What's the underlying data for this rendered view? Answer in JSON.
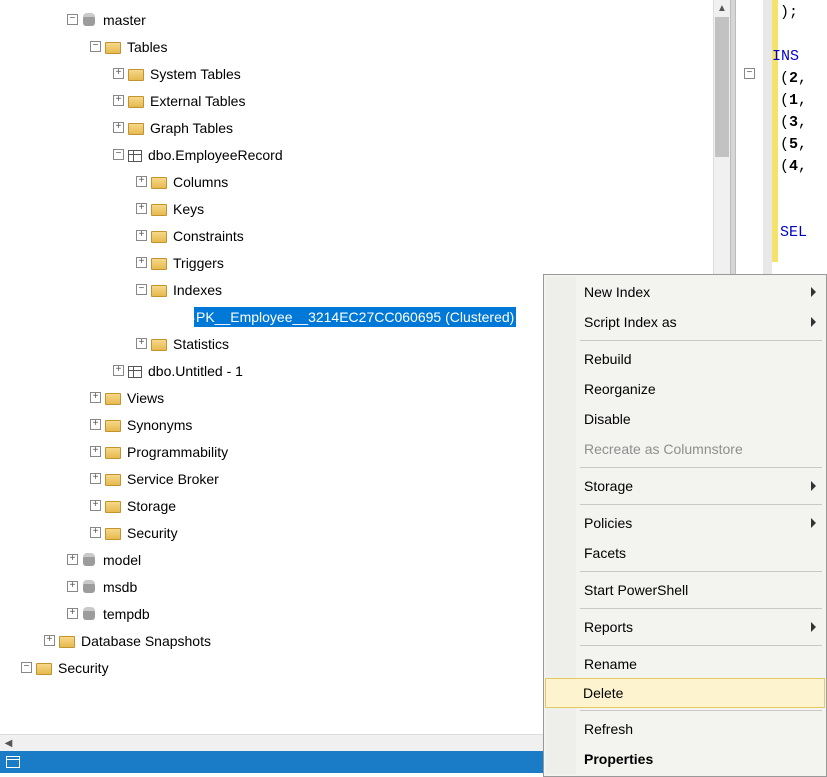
{
  "tree": {
    "master": "master",
    "tables": "Tables",
    "system_tables": "System Tables",
    "external_tables": "External Tables",
    "graph_tables": "Graph Tables",
    "employee_record": "dbo.EmployeeRecord",
    "columns": "Columns",
    "keys": "Keys",
    "constraints": "Constraints",
    "triggers": "Triggers",
    "indexes": "Indexes",
    "pk_index": "PK__Employee__3214EC27CC060695 (Clustered)",
    "statistics": "Statistics",
    "untitled": "dbo.Untitled - 1",
    "views": "Views",
    "synonyms": "Synonyms",
    "programmability": "Programmability",
    "service_broker": "Service Broker",
    "storage": "Storage",
    "security": "Security",
    "model": "model",
    "msdb": "msdb",
    "tempdb": "tempdb",
    "database_snapshots": "Database Snapshots",
    "root_security": "Security"
  },
  "menu": {
    "new_index": "New Index",
    "script_index": "Script Index as",
    "rebuild": "Rebuild",
    "reorganize": "Reorganize",
    "disable": "Disable",
    "recreate_columnstore": "Recreate as Columnstore",
    "storage": "Storage",
    "policies": "Policies",
    "facets": "Facets",
    "start_powershell": "Start PowerShell",
    "reports": "Reports",
    "rename": "Rename",
    "delete": "Delete",
    "refresh": "Refresh",
    "properties": "Properties"
  },
  "code": {
    "l1": ");",
    "l2": "INS",
    "l3": "(2,",
    "l4": "(1,",
    "l5": "(3,",
    "l6": "(5,",
    "l7": "(4,",
    "l8": "",
    "l9": "SEL"
  }
}
